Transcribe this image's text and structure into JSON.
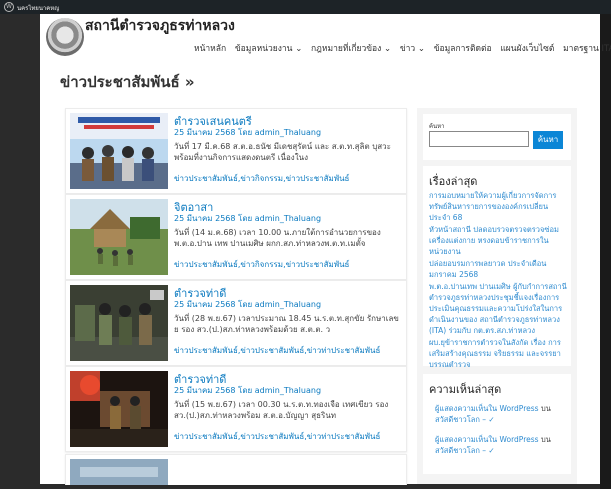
{
  "admin_bar": {
    "site_name": "นครไทยนาคหญ"
  },
  "header": {
    "site_title": "สถานีตำรวจภูธรท่าหลวง",
    "nav": [
      "หน้าหลัก",
      "ข้อมูลหน่วยงาน ⌄",
      "กฎหมายที่เกี่ยวข้อง ⌄",
      "ข่าว ⌄",
      "ข้อมูลการติดต่อ",
      "แผนผังเว็บไซต์",
      "มาตรฐาน ITA ⌄"
    ]
  },
  "page_title": "ข่าวประชาสัมพันธ์ »",
  "posts": [
    {
      "title": "ตำรวจเสนคนตรี",
      "meta": "25 มีนาคม 2568 โดย admin_Thaluang",
      "excerpt": "วันที่ 17 มี.ค.68 ส.ต.อ.ธนัช มีเดชสุรัตน์ และ ส.ต.ท.สุลิต บุสวะ พร้อมที่งานกิจการแสดงดนตรี เนื่องในง",
      "categories": "ข่าวประชาสัมพันธ์,ข่าวกิจกรรม,ข่าวประชาสัมพันธ์"
    },
    {
      "title": "จิตอาสา",
      "meta": "25 มีนาคม 2568 โดย admin_Thaluang",
      "excerpt": "วันที่ (14 ม.ค.68) เวลา 10.00 น.ภายใต้การอำนวยการของพ.ต.อ.ปาน เทพ ปานเมศิษ ผกก.สภ.ท่าหลวงพ.ต.ท.เมตั้จ",
      "categories": "ข่าวประชาสัมพันธ์,ข่าวกิจกรรม,ข่าวประชาสัมพันธ์"
    },
    {
      "title": "ตำรวจท่าดี",
      "meta": "25 มีนาคม 2568 โดย admin_Thaluang",
      "excerpt": "วันที่ (28 พ.ย.67) เวลาประมาณ 18.45 น.ร.ต.ท.สุกขัย รักษาเลขย รอง สว.(ป.)สภ.ท่าหลวงพร้อมด้วย ส.ต.ต. ว",
      "categories": "ข่าวประชาสัมพันธ์,ข่าวประชาสัมพันธ์,ข่าวท่าประชาสัมพันธ์"
    },
    {
      "title": "ตำรวจท่าดี",
      "meta": "25 มีนาคม 2568 โดย admin_Thaluang",
      "excerpt": "วันที่ (15 พ.ย.67) เวลา 00.30 น.ร.ต.ท.ทองเจือ เทศเขียว รอง สว.(ป.)สภ.ท่าหลวงพร้อม ส.ต.อ.บัญญา สุธรินท",
      "categories": "ข่าวประชาสัมพันธ์,ข่าวประชาสัมพันธ์,ข่าวท่าประชาสัมพันธ์"
    }
  ],
  "sidebar": {
    "search": {
      "label": "ค้นหา",
      "button": "ค้นหา",
      "value": ""
    },
    "recent_heading": "เรื่องล่าสุด",
    "recent_posts": [
      "การมอบหมายให้ความผู้เกี่ยวการจัดการทรัพย์สินหารายการขององค์กรเปลี่ยนประจำ 68",
      "หัวหน้าสถานี ปลดอบรวจตรวจตรวจซ่อมเครื่องแต่งกาย หรงดอบข้าราชการในหน่วยงาน",
      "ปล่อยอบรมการพลยาวด ประจำเดือนมกราคม 2568",
      "พ.ต.อ.ปานเทพ ปานเมศิษ ผู้กับกำการสถานีตำรวจภูธรท่าหลวงประชุมชี้แจงเรื่องการประเมินคุณธรรมและความโปร่งใสในการดำเนินงานของ สถานีตำรวจภูธรท่าหลวง (ITA) ร่วมกับ กต.ตร.สภ.ท่าหลวง",
      "ผบ.ยุข้าราชการตำรวจในสังกัด เรื่อง การเสริมสร้างคุณธรรม จริยธรรม และจรรยาบรรณตำรวจ"
    ],
    "comments_heading": "ความเห็นล่าสุด",
    "comments": [
      {
        "author": "ผู้แสดงความเห็นใน WordPress",
        "on": "บน",
        "post": "สวัสดีชาวโลก – ✓"
      },
      {
        "author": "ผู้แสดงความเห็นใน WordPress",
        "on": "บน",
        "post": "สวัสดีชาวโลก – ✓"
      }
    ]
  },
  "colors": {
    "link": "#0b7ac0",
    "button": "#0b86d6",
    "admin_bar": "#1d2327"
  }
}
